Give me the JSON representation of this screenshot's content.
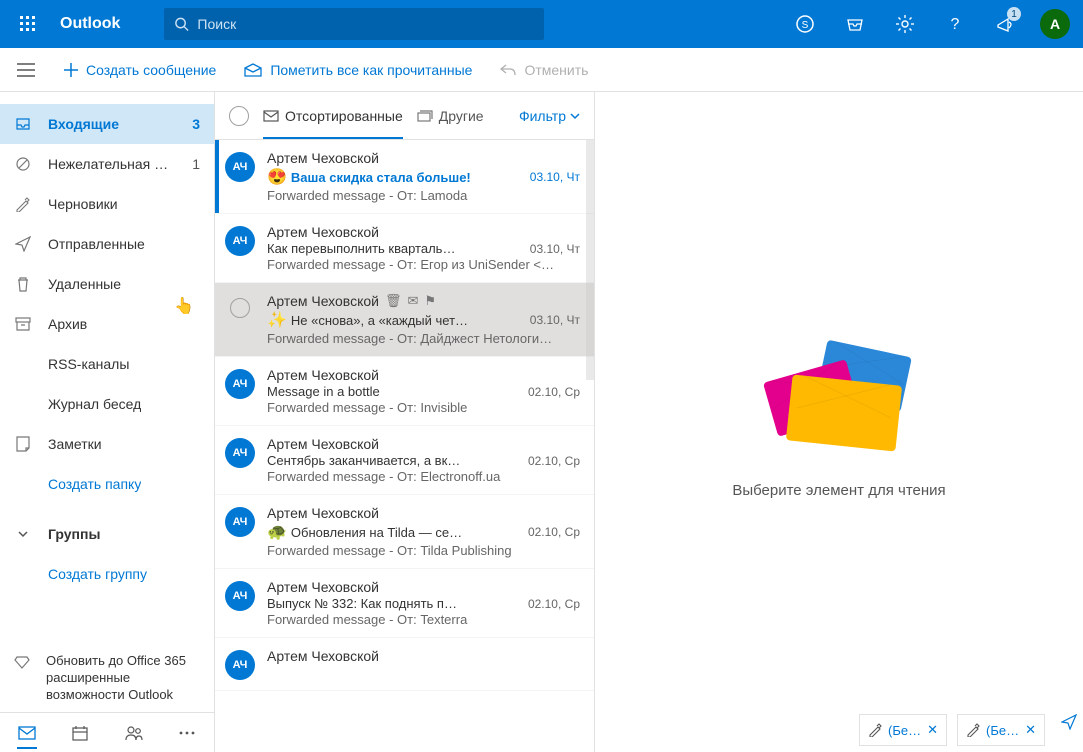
{
  "header": {
    "brand": "Outlook",
    "search_placeholder": "Поиск",
    "avatar_initial": "А",
    "notif_badge": "1"
  },
  "cmdbar": {
    "compose": "Создать сообщение",
    "mark_all": "Пометить все как прочитанные",
    "undo": "Отменить"
  },
  "nav": {
    "items": [
      {
        "label": "Входящие",
        "count": "3",
        "active": true,
        "icon": "inbox"
      },
      {
        "label": "Нежелательная …",
        "aux": "1",
        "icon": "block"
      },
      {
        "label": "Черновики",
        "icon": "pencil"
      },
      {
        "label": "Отправленные",
        "icon": "send"
      },
      {
        "label": "Удаленные",
        "icon": "trash"
      },
      {
        "label": "Архив",
        "icon": "archive"
      },
      {
        "label": "RSS-каналы",
        "sub": true
      },
      {
        "label": "Журнал бесед",
        "sub": true
      },
      {
        "label": "Заметки",
        "icon": "note"
      },
      {
        "label": "Создать папку",
        "link": true,
        "sub": true
      }
    ],
    "groups_header": "Группы",
    "create_group": "Создать группу",
    "upgrade": "Обновить до Office 365 расширенные возможности Outlook"
  },
  "list": {
    "select_all": "",
    "tab_focused": "Отсортированные",
    "tab_other": "Другие",
    "filter": "Фильтр"
  },
  "messages": [
    {
      "sender": "Артем Чеховской",
      "subject": "Ваша скидка стала больше!",
      "emoji": "😍",
      "preview": "Forwarded message - От: Lamoda <newsletter…",
      "date": "03.10, Чт",
      "unread": true,
      "bluebar": true
    },
    {
      "sender": "Артем Чеховской",
      "subject": "Как перевыполнить кварталь…",
      "preview": "Forwarded message - От: Егор из UniSender <…",
      "date": "03.10, Чт",
      "unread": false
    },
    {
      "sender": "Артем Чеховской",
      "subject": "Не «снова», а «каждый чет…",
      "hovicon": "✨",
      "preview": "Forwarded message - От: Дайджест Нетологи…",
      "date": "03.10, Чт",
      "hover": true
    },
    {
      "sender": "Артем Чеховской",
      "subject": "Message in a bottle",
      "preview": "Forwarded message - От: Invisible <info@invis…",
      "date": "02.10, Ср"
    },
    {
      "sender": "Артем Чеховской",
      "subject": "Сентябрь заканчивается, а вк…",
      "preview": "Forwarded message - От: Electronoff.ua <sales…",
      "date": "02.10, Ср"
    },
    {
      "sender": "Артем Чеховской",
      "subject": "Обновления на Tilda — се…",
      "emoji": "🐢",
      "preview": "Forwarded message - От: Tilda Publishing <hel…",
      "date": "02.10, Ср"
    },
    {
      "sender": "Артем Чеховской",
      "subject": "Выпуск № 332: Как поднять п…",
      "preview": "Forwarded message - От: Texterra <partizan@…",
      "date": "02.10, Ср"
    },
    {
      "sender": "Артем Чеховской",
      "subject": "",
      "preview": "",
      "date": ""
    }
  ],
  "reader": {
    "empty": "Выберите элемент для чтения"
  },
  "drafts": {
    "tab1": "(Бе…",
    "tab2": "(Бе…"
  },
  "avatar_initials": "АЧ"
}
